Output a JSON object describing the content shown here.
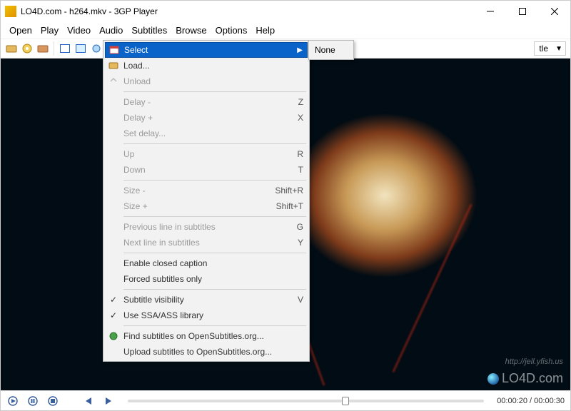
{
  "title": "LO4D.com - h264.mkv - 3GP Player",
  "menubar": [
    "Open",
    "Play",
    "Video",
    "Audio",
    "Subtitles",
    "Browse",
    "Options",
    "Help"
  ],
  "toolbar": {
    "combo_text": "tle"
  },
  "submenu": {
    "item": "None"
  },
  "menu": {
    "select": "Select",
    "load": "Load...",
    "unload": "Unload",
    "delay_minus": "Delay -",
    "delay_minus_k": "Z",
    "delay_plus": "Delay +",
    "delay_plus_k": "X",
    "set_delay": "Set delay...",
    "up": "Up",
    "up_k": "R",
    "down": "Down",
    "down_k": "T",
    "size_minus": "Size -",
    "size_minus_k": "Shift+R",
    "size_plus": "Size +",
    "size_plus_k": "Shift+T",
    "prev_line": "Previous line in subtitles",
    "prev_line_k": "G",
    "next_line": "Next line in subtitles",
    "next_line_k": "Y",
    "enable_cc": "Enable closed caption",
    "forced": "Forced subtitles only",
    "visibility": "Subtitle visibility",
    "visibility_k": "V",
    "ssa": "Use SSA/ASS library",
    "find": "Find subtitles on OpenSubtitles.org...",
    "upload": "Upload subtitles to OpenSubtitles.org..."
  },
  "video": {
    "url_hint": "http://jell.yfish.us"
  },
  "watermark": "LO4D.com",
  "time": "00:00:20 / 00:00:30"
}
